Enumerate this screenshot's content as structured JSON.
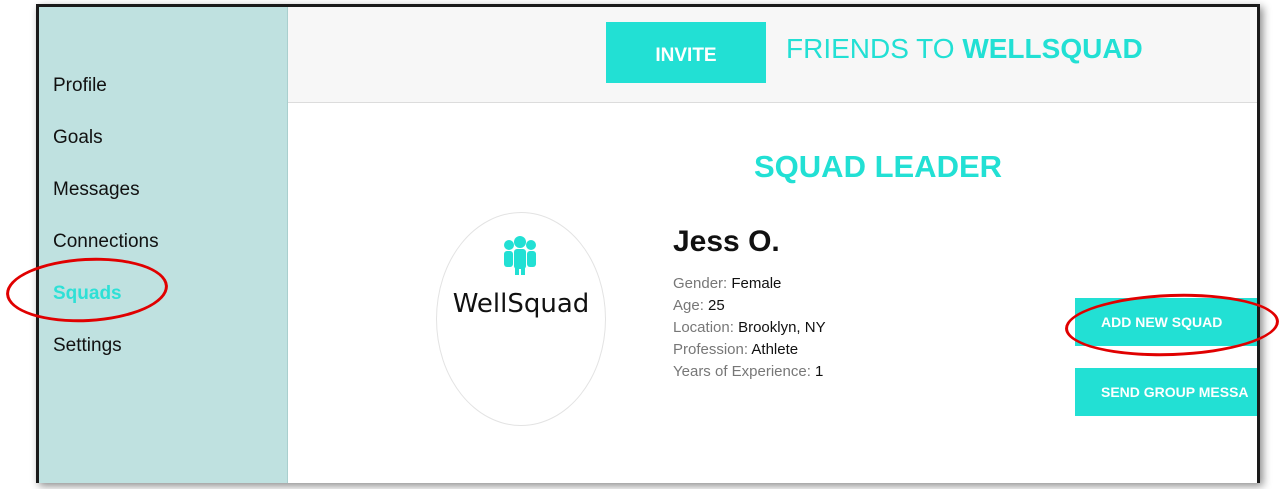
{
  "sidebar": {
    "items": [
      {
        "label": "Profile"
      },
      {
        "label": "Goals"
      },
      {
        "label": "Messages"
      },
      {
        "label": "Connections"
      },
      {
        "label": "Squads"
      },
      {
        "label": "Settings"
      }
    ],
    "active_item": "Squads"
  },
  "header": {
    "invite_button": "INVITE",
    "invite_text_prefix": "FRIENDS TO ",
    "invite_text_brand": "WELLSQUAD"
  },
  "leader": {
    "section_title": "SQUAD LEADER",
    "logo_text": "WellSquad",
    "logo_icon": "group-people-icon",
    "name": "Jess O.",
    "details": [
      {
        "label": "Gender:",
        "value": "Female"
      },
      {
        "label": "Age:",
        "value": "25"
      },
      {
        "label": "Location:",
        "value": "Brooklyn, NY"
      },
      {
        "label": "Profession:",
        "value": "Athlete"
      },
      {
        "label": "Years of Experience:",
        "value": "1"
      }
    ]
  },
  "actions": {
    "add_squad": "ADD NEW SQUAD",
    "send_group_message": "SEND GROUP MESSA"
  },
  "colors": {
    "accent": "#22e0d4",
    "sidebar_bg": "#bfe1e0",
    "highlight_ring": "#e00000"
  }
}
